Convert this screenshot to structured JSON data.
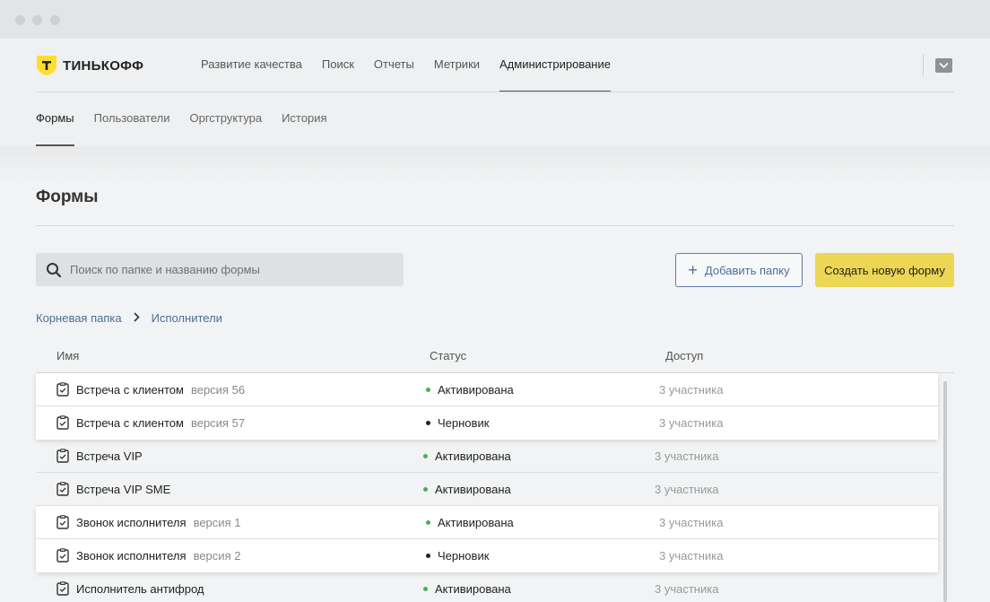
{
  "brand": {
    "name": "ТИНЬКОФФ",
    "logo_letter": "Т",
    "color": "#FFDD2D"
  },
  "nav": {
    "items": [
      {
        "label": "Развитие качества",
        "active": false
      },
      {
        "label": "Поиск",
        "active": false
      },
      {
        "label": "Отчеты",
        "active": false
      },
      {
        "label": "Метрики",
        "active": false
      },
      {
        "label": "Администрирование",
        "active": true
      }
    ]
  },
  "subnav": {
    "items": [
      {
        "label": "Формы",
        "active": true
      },
      {
        "label": "Пользователи",
        "active": false
      },
      {
        "label": "Оргструктура",
        "active": false
      },
      {
        "label": "История",
        "active": false
      }
    ]
  },
  "page": {
    "title": "Формы"
  },
  "search": {
    "placeholder": "Поиск по папке и названию формы",
    "value": ""
  },
  "actions": {
    "add_folder_label": "Добавить папку",
    "create_form_label": "Создать новую форму",
    "accent_color": "#ECD654"
  },
  "breadcrumb": {
    "root": "Корневая папка",
    "current": "Исполнители"
  },
  "table": {
    "columns": {
      "name": "Имя",
      "status": "Статус",
      "access": "Доступ"
    },
    "rows": [
      {
        "name": "Встреча с клиентом",
        "version": "версия 56",
        "status": "Активирована",
        "status_color": "#4caf50",
        "access": "3 участника",
        "group": 1
      },
      {
        "name": "Встреча с клиентом",
        "version": "версия 57",
        "status": "Черновик",
        "status_color": "#222222",
        "access": "3 участника",
        "group": 1
      },
      {
        "name": "Встреча VIP",
        "version": "",
        "status": "Активирована",
        "status_color": "#4caf50",
        "access": "3 участника",
        "group": 0
      },
      {
        "name": "Встреча VIP SME",
        "version": "",
        "status": "Активирована",
        "status_color": "#4caf50",
        "access": "3 участника",
        "group": 0
      },
      {
        "name": "Звонок исполнителя",
        "version": "версия 1",
        "status": "Активирована",
        "status_color": "#4caf50",
        "access": "3 участника",
        "group": 2
      },
      {
        "name": "Звонок исполнителя",
        "version": "версия 2",
        "status": "Черновик",
        "status_color": "#222222",
        "access": "3 участника",
        "group": 2
      },
      {
        "name": "Исполнитель антифрод",
        "version": "",
        "status": "Активирована",
        "status_color": "#4caf50",
        "access": "3 участника",
        "group": 0
      }
    ]
  }
}
